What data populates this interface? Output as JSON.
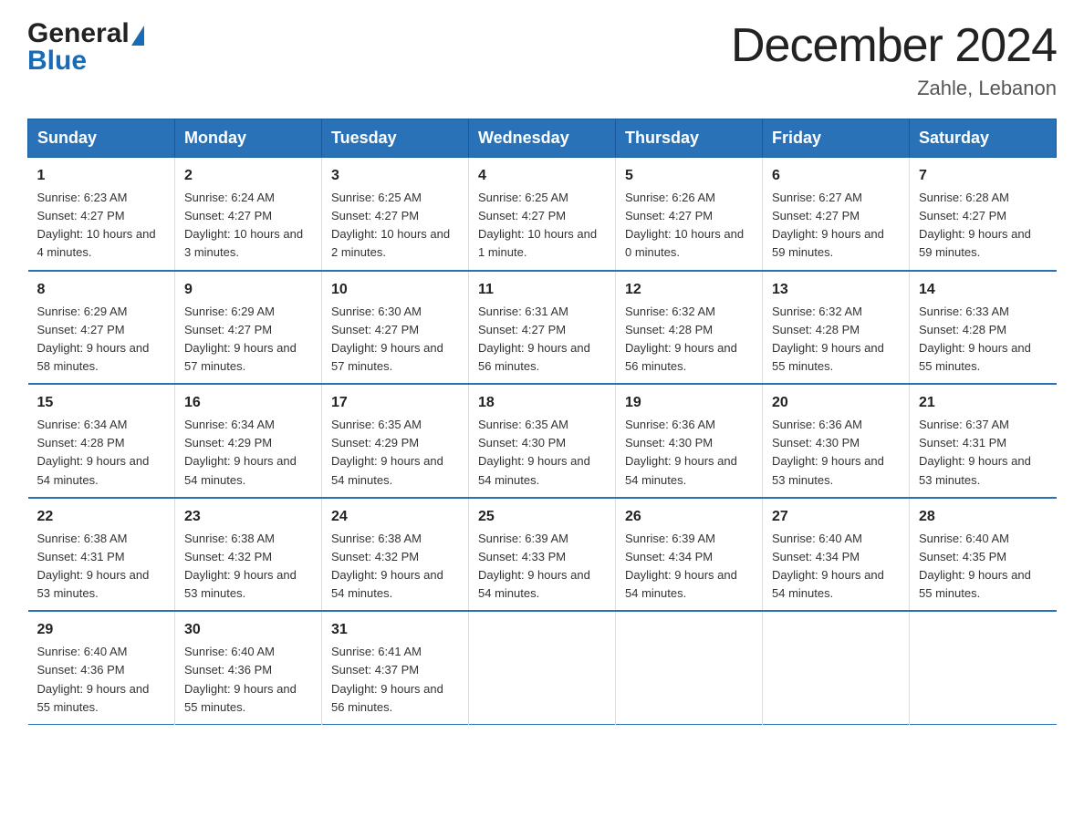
{
  "header": {
    "logo_general": "General",
    "logo_blue": "Blue",
    "title": "December 2024",
    "subtitle": "Zahle, Lebanon"
  },
  "weekdays": [
    "Sunday",
    "Monday",
    "Tuesday",
    "Wednesday",
    "Thursday",
    "Friday",
    "Saturday"
  ],
  "weeks": [
    [
      {
        "day": "1",
        "sunrise": "6:23 AM",
        "sunset": "4:27 PM",
        "daylight": "10 hours and 4 minutes."
      },
      {
        "day": "2",
        "sunrise": "6:24 AM",
        "sunset": "4:27 PM",
        "daylight": "10 hours and 3 minutes."
      },
      {
        "day": "3",
        "sunrise": "6:25 AM",
        "sunset": "4:27 PM",
        "daylight": "10 hours and 2 minutes."
      },
      {
        "day": "4",
        "sunrise": "6:25 AM",
        "sunset": "4:27 PM",
        "daylight": "10 hours and 1 minute."
      },
      {
        "day": "5",
        "sunrise": "6:26 AM",
        "sunset": "4:27 PM",
        "daylight": "10 hours and 0 minutes."
      },
      {
        "day": "6",
        "sunrise": "6:27 AM",
        "sunset": "4:27 PM",
        "daylight": "9 hours and 59 minutes."
      },
      {
        "day": "7",
        "sunrise": "6:28 AM",
        "sunset": "4:27 PM",
        "daylight": "9 hours and 59 minutes."
      }
    ],
    [
      {
        "day": "8",
        "sunrise": "6:29 AM",
        "sunset": "4:27 PM",
        "daylight": "9 hours and 58 minutes."
      },
      {
        "day": "9",
        "sunrise": "6:29 AM",
        "sunset": "4:27 PM",
        "daylight": "9 hours and 57 minutes."
      },
      {
        "day": "10",
        "sunrise": "6:30 AM",
        "sunset": "4:27 PM",
        "daylight": "9 hours and 57 minutes."
      },
      {
        "day": "11",
        "sunrise": "6:31 AM",
        "sunset": "4:27 PM",
        "daylight": "9 hours and 56 minutes."
      },
      {
        "day": "12",
        "sunrise": "6:32 AM",
        "sunset": "4:28 PM",
        "daylight": "9 hours and 56 minutes."
      },
      {
        "day": "13",
        "sunrise": "6:32 AM",
        "sunset": "4:28 PM",
        "daylight": "9 hours and 55 minutes."
      },
      {
        "day": "14",
        "sunrise": "6:33 AM",
        "sunset": "4:28 PM",
        "daylight": "9 hours and 55 minutes."
      }
    ],
    [
      {
        "day": "15",
        "sunrise": "6:34 AM",
        "sunset": "4:28 PM",
        "daylight": "9 hours and 54 minutes."
      },
      {
        "day": "16",
        "sunrise": "6:34 AM",
        "sunset": "4:29 PM",
        "daylight": "9 hours and 54 minutes."
      },
      {
        "day": "17",
        "sunrise": "6:35 AM",
        "sunset": "4:29 PM",
        "daylight": "9 hours and 54 minutes."
      },
      {
        "day": "18",
        "sunrise": "6:35 AM",
        "sunset": "4:30 PM",
        "daylight": "9 hours and 54 minutes."
      },
      {
        "day": "19",
        "sunrise": "6:36 AM",
        "sunset": "4:30 PM",
        "daylight": "9 hours and 54 minutes."
      },
      {
        "day": "20",
        "sunrise": "6:36 AM",
        "sunset": "4:30 PM",
        "daylight": "9 hours and 53 minutes."
      },
      {
        "day": "21",
        "sunrise": "6:37 AM",
        "sunset": "4:31 PM",
        "daylight": "9 hours and 53 minutes."
      }
    ],
    [
      {
        "day": "22",
        "sunrise": "6:38 AM",
        "sunset": "4:31 PM",
        "daylight": "9 hours and 53 minutes."
      },
      {
        "day": "23",
        "sunrise": "6:38 AM",
        "sunset": "4:32 PM",
        "daylight": "9 hours and 53 minutes."
      },
      {
        "day": "24",
        "sunrise": "6:38 AM",
        "sunset": "4:32 PM",
        "daylight": "9 hours and 54 minutes."
      },
      {
        "day": "25",
        "sunrise": "6:39 AM",
        "sunset": "4:33 PM",
        "daylight": "9 hours and 54 minutes."
      },
      {
        "day": "26",
        "sunrise": "6:39 AM",
        "sunset": "4:34 PM",
        "daylight": "9 hours and 54 minutes."
      },
      {
        "day": "27",
        "sunrise": "6:40 AM",
        "sunset": "4:34 PM",
        "daylight": "9 hours and 54 minutes."
      },
      {
        "day": "28",
        "sunrise": "6:40 AM",
        "sunset": "4:35 PM",
        "daylight": "9 hours and 55 minutes."
      }
    ],
    [
      {
        "day": "29",
        "sunrise": "6:40 AM",
        "sunset": "4:36 PM",
        "daylight": "9 hours and 55 minutes."
      },
      {
        "day": "30",
        "sunrise": "6:40 AM",
        "sunset": "4:36 PM",
        "daylight": "9 hours and 55 minutes."
      },
      {
        "day": "31",
        "sunrise": "6:41 AM",
        "sunset": "4:37 PM",
        "daylight": "9 hours and 56 minutes."
      },
      {
        "day": "",
        "sunrise": "",
        "sunset": "",
        "daylight": ""
      },
      {
        "day": "",
        "sunrise": "",
        "sunset": "",
        "daylight": ""
      },
      {
        "day": "",
        "sunrise": "",
        "sunset": "",
        "daylight": ""
      },
      {
        "day": "",
        "sunrise": "",
        "sunset": "",
        "daylight": ""
      }
    ]
  ]
}
